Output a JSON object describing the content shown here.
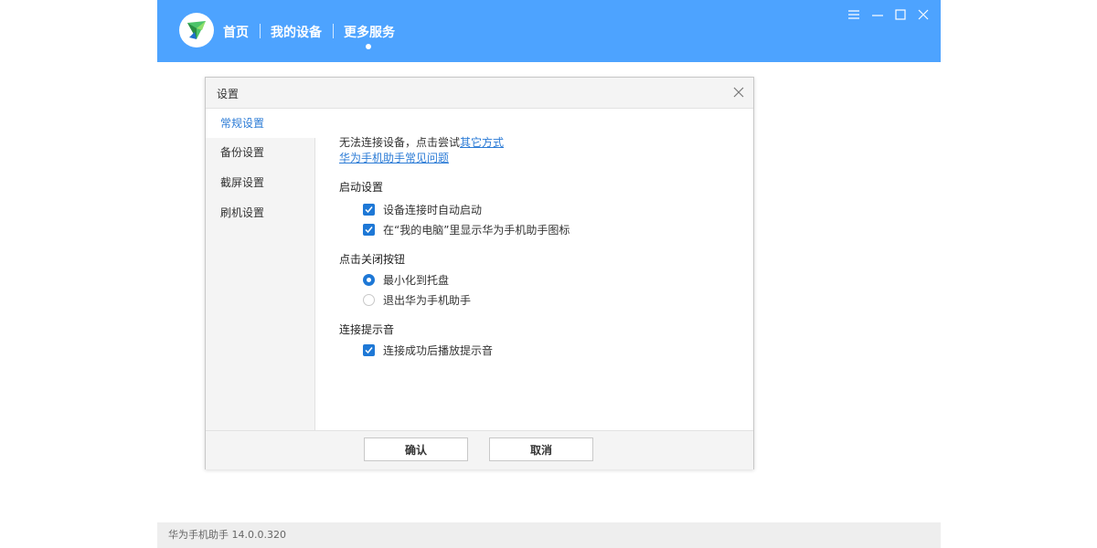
{
  "app": {
    "nav": [
      "首页",
      "我的设备",
      "更多服务"
    ],
    "accent_color": "#4da3ff",
    "window_controls": [
      "menu-icon",
      "minimize-icon",
      "maximize-icon",
      "close-icon"
    ],
    "status_text": "华为手机助手 14.0.0.320"
  },
  "dialog": {
    "title": "设置",
    "sidebar": [
      "常规设置",
      "备份设置",
      "截屏设置",
      "刷机设置"
    ],
    "active_sidebar": "常规设置",
    "intro_text": "无法连接设备，点击尝试",
    "intro_link": "其它方式",
    "faq_link": "华为手机助手常见问题",
    "sections": {
      "startup": {
        "title": "启动设置",
        "options": [
          {
            "label": "设备连接时自动启动",
            "checked": true
          },
          {
            "label": "在“我的电脑”里显示华为手机助手图标",
            "checked": true
          }
        ]
      },
      "close": {
        "title": "点击关闭按钮",
        "options": [
          {
            "label": "最小化到托盘",
            "selected": true
          },
          {
            "label": "退出华为手机助手",
            "selected": false
          }
        ]
      },
      "sound": {
        "title": "连接提示音",
        "options": [
          {
            "label": "连接成功后播放提示音",
            "checked": true
          }
        ]
      }
    },
    "confirm_label": "确认",
    "cancel_label": "取消"
  }
}
